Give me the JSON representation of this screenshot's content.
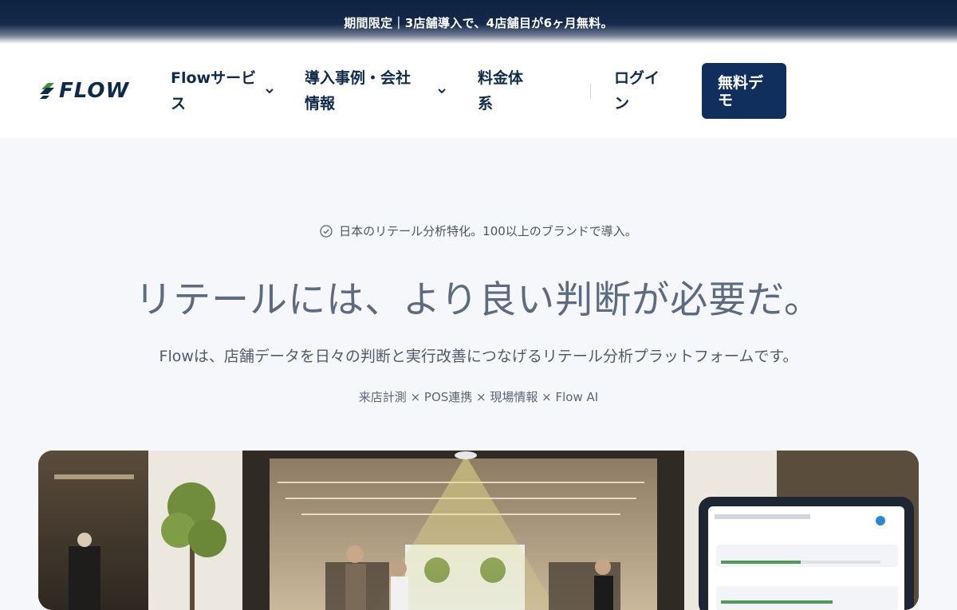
{
  "banner": {
    "text": "期間限定｜3店舗導入で、4店舗目が6ヶ月無料。"
  },
  "header": {
    "logo_text": "FLOW",
    "nav": [
      {
        "label_line1": "Flowサービ",
        "label_line2": "ス",
        "has_dropdown": true
      },
      {
        "label_line1": "導入事例・会社",
        "label_line2": "情報",
        "has_dropdown": true
      },
      {
        "label_line1": "料金体",
        "label_line2": "系",
        "has_dropdown": false
      },
      {
        "label_line1": "ログイ",
        "label_line2": "ン",
        "has_dropdown": false
      }
    ],
    "demo_button": {
      "line1": "無料デ",
      "line2": "モ"
    }
  },
  "hero": {
    "tagline": "日本のリテール分析特化。100以上のブランドで導入。",
    "headline": "リテールには、より良い判断が必要だ。",
    "subline": "Flowは、店舗データを日々の判断と実行改善につなげるリテール分析プラットフォームです。",
    "features": "来店計測 × POS連携 × 現場情報 × Flow AI"
  },
  "colors": {
    "navy": "#102a4c",
    "button_bg": "#102f5c",
    "logo_accent": "#3f8f3a",
    "hero_bg": "#f5f7fa"
  },
  "icons": {
    "tagline_icon": "check-circle-icon",
    "nav_dropdown_icon": "chevron-down-icon"
  }
}
